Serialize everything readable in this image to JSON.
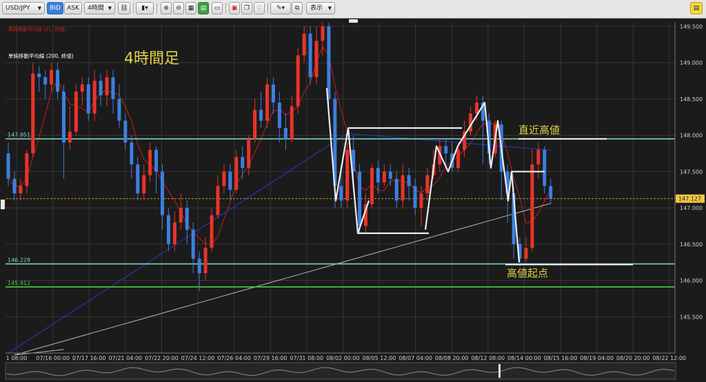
{
  "toolbar": {
    "symbol": "USD/JPY",
    "bid_label": "BID",
    "ask_label": "ASK",
    "timeframe": "4時間",
    "display_label": "表示"
  },
  "legend": {
    "sma21": "単純移動平均線 (21, 終値)",
    "sma200": "単純移動平均線 (200, 終値)"
  },
  "chart_data": {
    "type": "candlestick",
    "title": "4時間足",
    "ylim": [
      145.0,
      149.55
    ],
    "y_ticks": [
      "149.500",
      "149.000",
      "148.500",
      "148.000",
      "147.500",
      "147.000",
      "146.500",
      "146.000",
      "145.500"
    ],
    "x_ticks": [
      "1 08:00",
      "07/16 00:00",
      "07/17 16:00",
      "07/21 04:00",
      "07/22 20:00",
      "07/24 12:00",
      "07/26 04:00",
      "07/29 16:00",
      "07/31 08:00",
      "08/02 00:00",
      "08/05 12:00",
      "08/07 04:00",
      "08/08 20:00",
      "08/12 08:00",
      "08/14 00:00",
      "08/15 16:00",
      "08/19 04:00",
      "08/20 20:00",
      "08/22 12:00"
    ],
    "current_price": 147.127,
    "levels": [
      {
        "value": 147.951,
        "label": "147.951",
        "color": "#7fd3c6"
      },
      {
        "value": 146.228,
        "label": "146.228",
        "color": "#7fd3c6"
      },
      {
        "value": 145.912,
        "label": "145.912",
        "color": "#46d046"
      }
    ],
    "annotations": [
      "直近高値",
      "高値起点"
    ],
    "colors": {
      "up": "#e8342a",
      "down": "#3d7fe0",
      "sma21": "#c8201c",
      "sma200": "#b9b9b9",
      "sma_mid": "#2433a8"
    },
    "candles": [
      [
        147.75,
        147.4,
        147.9,
        147.3
      ],
      [
        147.4,
        147.2,
        147.5,
        147.1
      ],
      [
        147.2,
        147.3,
        147.4,
        147.1
      ],
      [
        147.3,
        147.75,
        147.8,
        147.2
      ],
      [
        147.75,
        148.85,
        149.0,
        147.7
      ],
      [
        148.85,
        148.8,
        148.95,
        148.6
      ],
      [
        148.8,
        148.7,
        148.9,
        148.5
      ],
      [
        148.7,
        148.9,
        149.0,
        148.6
      ],
      [
        148.9,
        148.6,
        149.0,
        148.5
      ],
      [
        148.6,
        147.9,
        148.7,
        147.4
      ],
      [
        147.9,
        148.05,
        148.4,
        147.8
      ],
      [
        148.05,
        148.6,
        148.7,
        148.0
      ],
      [
        148.6,
        148.7,
        148.8,
        148.4
      ],
      [
        148.7,
        148.3,
        148.8,
        148.2
      ],
      [
        148.3,
        148.75,
        148.9,
        148.2
      ],
      [
        148.75,
        148.55,
        148.85,
        148.4
      ],
      [
        148.55,
        148.8,
        148.9,
        148.4
      ],
      [
        148.8,
        148.5,
        148.9,
        148.3
      ],
      [
        148.5,
        148.2,
        148.7,
        148.1
      ],
      [
        148.2,
        147.9,
        148.3,
        147.8
      ],
      [
        147.9,
        147.6,
        148.0,
        147.4
      ],
      [
        147.6,
        147.2,
        147.7,
        147.1
      ],
      [
        147.2,
        147.45,
        147.6,
        147.1
      ],
      [
        147.45,
        147.8,
        147.9,
        147.35
      ],
      [
        147.8,
        147.5,
        147.85,
        147.2
      ],
      [
        147.5,
        146.9,
        147.6,
        146.7
      ],
      [
        146.9,
        146.5,
        147.0,
        146.4
      ],
      [
        146.5,
        146.8,
        146.95,
        146.4
      ],
      [
        146.8,
        147.0,
        147.2,
        146.7
      ],
      [
        147.0,
        146.7,
        147.1,
        146.5
      ],
      [
        146.7,
        146.3,
        146.8,
        146.1
      ],
      [
        146.3,
        146.1,
        146.4,
        145.85
      ],
      [
        146.1,
        146.45,
        146.6,
        146.0
      ],
      [
        146.45,
        146.9,
        147.0,
        146.4
      ],
      [
        146.9,
        147.3,
        147.45,
        146.85
      ],
      [
        147.3,
        147.5,
        147.6,
        147.2
      ],
      [
        147.5,
        147.25,
        147.6,
        147.1
      ],
      [
        147.25,
        147.7,
        147.8,
        147.2
      ],
      [
        147.7,
        147.55,
        147.85,
        147.4
      ],
      [
        147.55,
        147.95,
        148.0,
        147.45
      ],
      [
        147.95,
        148.35,
        148.5,
        147.9
      ],
      [
        148.35,
        148.2,
        148.6,
        148.1
      ],
      [
        148.2,
        148.7,
        148.8,
        148.1
      ],
      [
        148.7,
        148.45,
        148.8,
        148.3
      ],
      [
        148.45,
        148.1,
        148.6,
        147.9
      ],
      [
        148.1,
        147.95,
        148.3,
        147.8
      ],
      [
        147.95,
        148.4,
        148.55,
        147.9
      ],
      [
        148.4,
        149.1,
        149.2,
        148.3
      ],
      [
        149.1,
        149.4,
        149.5,
        149.0
      ],
      [
        149.4,
        148.8,
        149.5,
        148.7
      ],
      [
        148.8,
        149.3,
        149.5,
        148.7
      ],
      [
        149.3,
        149.5,
        149.55,
        149.1
      ],
      [
        149.5,
        148.5,
        149.55,
        148.2
      ],
      [
        148.5,
        147.3,
        148.6,
        147.0
      ],
      [
        147.3,
        147.1,
        147.6,
        147.0
      ],
      [
        147.1,
        147.8,
        147.9,
        147.0
      ],
      [
        147.8,
        147.5,
        148.0,
        147.3
      ],
      [
        147.5,
        146.75,
        147.6,
        146.65
      ],
      [
        146.75,
        147.05,
        147.2,
        146.65
      ],
      [
        147.05,
        147.55,
        147.6,
        147.0
      ],
      [
        147.55,
        147.35,
        147.65,
        147.2
      ],
      [
        147.35,
        147.5,
        147.6,
        147.3
      ],
      [
        147.5,
        147.4,
        147.6,
        147.3
      ],
      [
        147.4,
        147.1,
        147.5,
        147.0
      ],
      [
        147.1,
        147.45,
        147.6,
        147.0
      ],
      [
        147.45,
        147.3,
        147.55,
        147.1
      ],
      [
        147.3,
        147.0,
        147.4,
        146.9
      ],
      [
        147.0,
        147.2,
        147.3,
        146.75
      ],
      [
        147.2,
        147.45,
        147.55,
        147.1
      ],
      [
        147.45,
        147.6,
        147.8,
        147.4
      ],
      [
        147.6,
        147.85,
        147.95,
        147.5
      ],
      [
        147.85,
        147.75,
        147.95,
        147.6
      ],
      [
        147.75,
        147.55,
        147.9,
        147.5
      ],
      [
        147.55,
        147.8,
        147.9,
        147.5
      ],
      [
        147.8,
        148.05,
        148.2,
        147.7
      ],
      [
        148.05,
        148.3,
        148.4,
        148.0
      ],
      [
        148.3,
        148.45,
        148.55,
        148.2
      ],
      [
        148.45,
        148.2,
        148.55,
        147.6
      ],
      [
        148.2,
        147.75,
        148.3,
        147.6
      ],
      [
        147.75,
        148.15,
        148.2,
        147.7
      ],
      [
        148.15,
        147.5,
        148.2,
        147.1
      ],
      [
        147.5,
        147.2,
        147.6,
        146.8
      ],
      [
        147.2,
        146.5,
        147.3,
        146.3
      ],
      [
        146.5,
        146.3,
        146.6,
        146.2
      ],
      [
        146.3,
        146.45,
        146.6,
        146.25
      ],
      [
        146.45,
        147.6,
        147.8,
        146.4
      ],
      [
        147.6,
        147.8,
        147.9,
        147.4
      ],
      [
        147.8,
        147.3,
        147.85,
        147.2
      ],
      [
        147.3,
        147.13,
        147.4,
        147.05
      ]
    ]
  }
}
